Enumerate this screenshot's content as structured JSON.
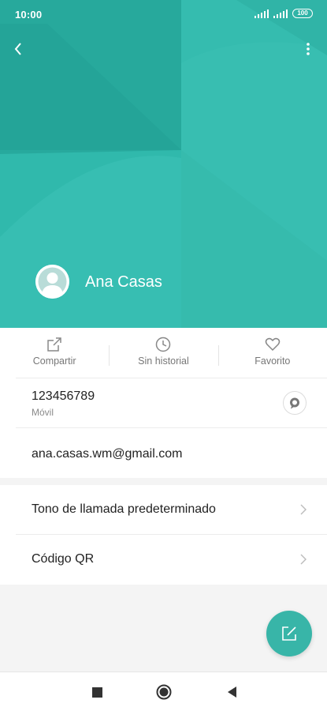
{
  "status_bar": {
    "time": "10:00",
    "battery": "100"
  },
  "header": {
    "back_icon": "chevron-left-icon",
    "more_icon": "more-vertical-icon"
  },
  "contact": {
    "name": "Ana Casas",
    "avatar_icon": "person-avatar-icon"
  },
  "actions": [
    {
      "label": "Compartir",
      "icon": "share-icon"
    },
    {
      "label": "Sin historial",
      "icon": "clock-icon"
    },
    {
      "label": "Favorito",
      "icon": "heart-icon"
    }
  ],
  "phone": {
    "number": "123456789",
    "type": "Móvil",
    "message_icon": "message-icon"
  },
  "email": "ana.casas.wm@gmail.com",
  "settings": [
    {
      "label": "Tono de llamada predeterminado"
    },
    {
      "label": "Código QR"
    }
  ],
  "fab": {
    "icon": "edit-icon"
  },
  "colors": {
    "header": "#2bb3a6",
    "accent": "#38b5a8"
  }
}
